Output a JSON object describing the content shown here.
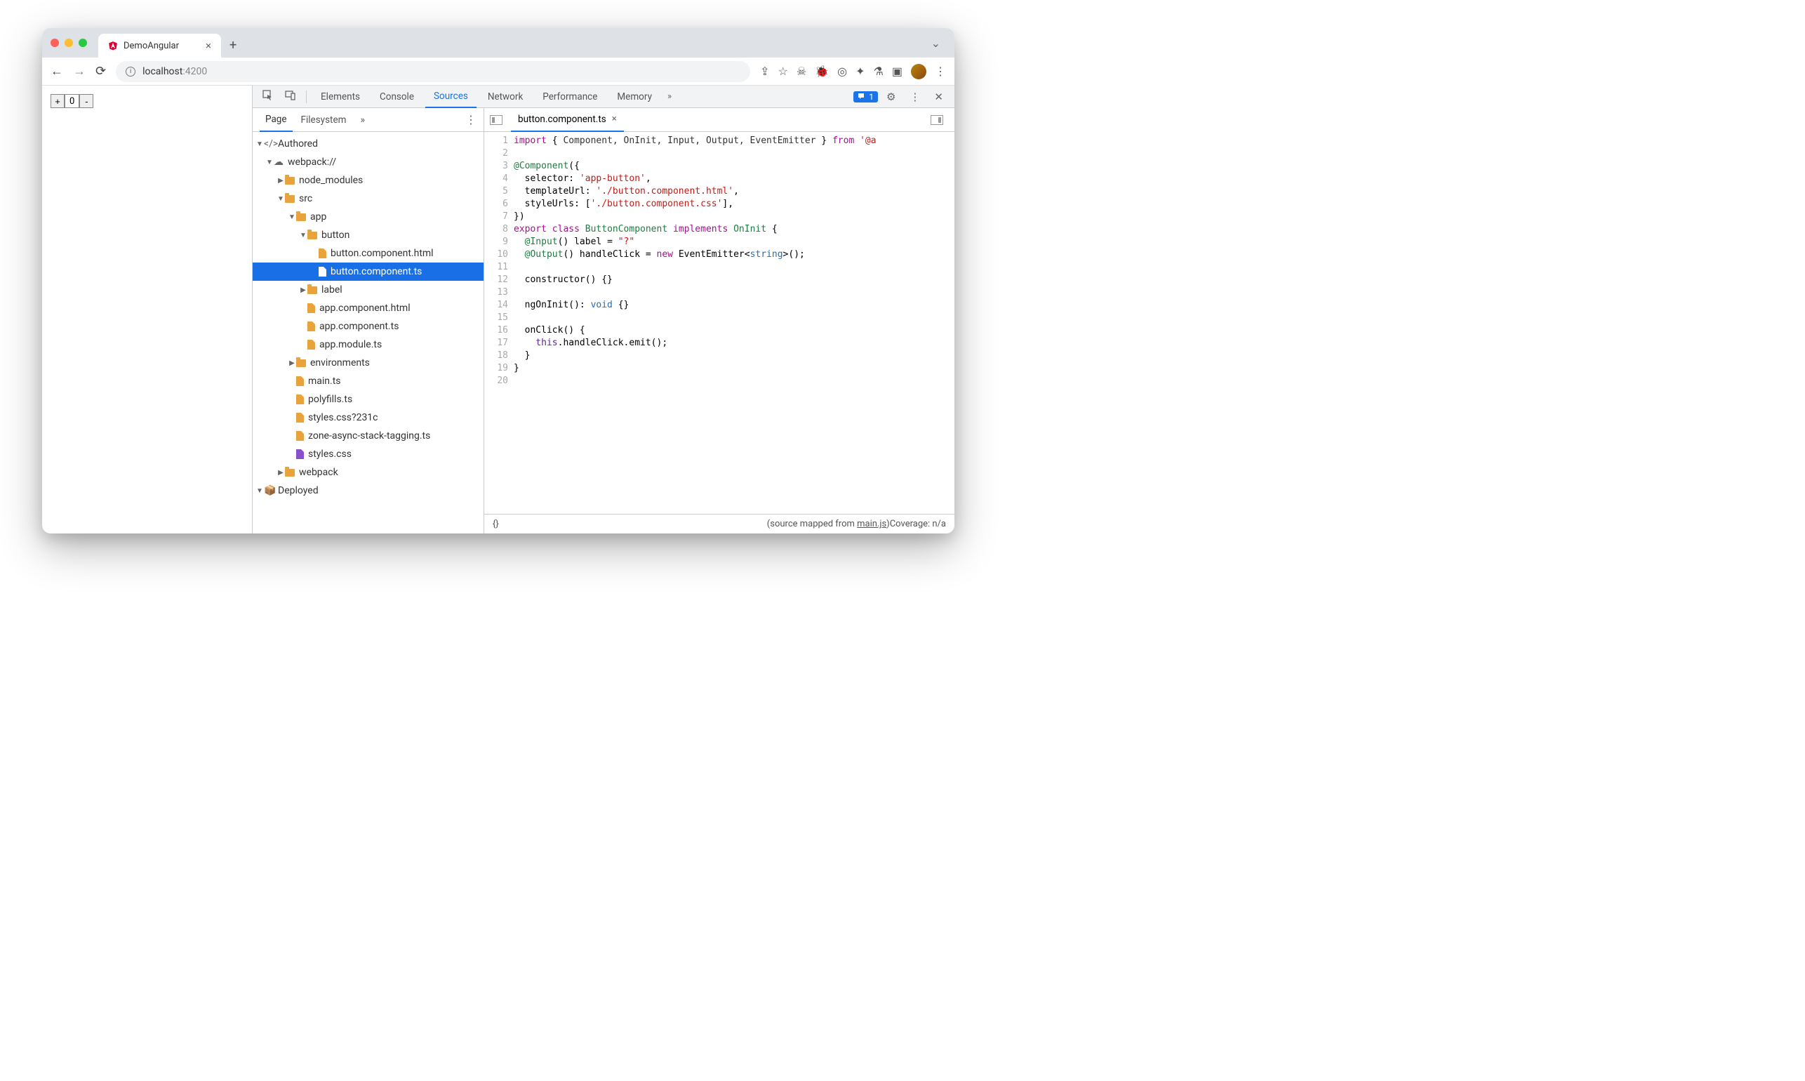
{
  "browser": {
    "tab_title": "DemoAngular",
    "url_host": "localhost",
    "url_port": ":4200"
  },
  "page": {
    "counter_minus": "-",
    "counter_value": "0",
    "counter_plus": "+"
  },
  "devtools": {
    "tabs": [
      "Elements",
      "Console",
      "Sources",
      "Network",
      "Performance",
      "Memory"
    ],
    "active_tab": "Sources",
    "more_glyph": "»",
    "issues_badge": "1",
    "sidebar_tabs": [
      "Page",
      "Filesystem"
    ],
    "sidebar_more": "»",
    "active_sidebar_tab": "Page",
    "tree": {
      "authored": "Authored",
      "webpack": "webpack://",
      "node_modules": "node_modules",
      "src": "src",
      "app": "app",
      "button": "button",
      "button_html": "button.component.html",
      "button_ts": "button.component.ts",
      "label": "label",
      "app_html": "app.component.html",
      "app_ts": "app.component.ts",
      "app_module": "app.module.ts",
      "environments": "environments",
      "main_ts": "main.ts",
      "polyfills": "polyfills.ts",
      "styles_q": "styles.css?231c",
      "zone": "zone-async-stack-tagging.ts",
      "styles": "styles.css",
      "webpack_folder": "webpack",
      "deployed": "Deployed"
    },
    "open_file": "button.component.ts",
    "code_lines": {
      "1": {
        "import": "import",
        "lb": " { ",
        "ids": "Component, OnInit, Input, Output, EventEmitter",
        "rb": " } ",
        "from": "from",
        "str": "'@a"
      },
      "2": "",
      "3": {
        "deco": "@Component",
        "rest": "({"
      },
      "4": {
        "key": "  selector: ",
        "val": "'app-button'",
        "end": ","
      },
      "5": {
        "key": "  templateUrl: ",
        "val": "'./button.component.html'",
        "end": ","
      },
      "6": {
        "key": "  styleUrls: [",
        "val": "'./button.component.css'",
        "end": "],"
      },
      "7": "})",
      "8": {
        "exp": "export",
        "cls": "class",
        "name": "ButtonComponent",
        "impl": "implements",
        "iface": "OnInit",
        "end": " {"
      },
      "9": {
        "deco": "  @Input",
        "rest": "() label = ",
        "val": "\"?\""
      },
      "10": {
        "deco": "  @Output",
        "rest": "() handleClick = ",
        "new": "new",
        "type": " EventEmitter<",
        "gen": "string",
        "end": ">();"
      },
      "11": "",
      "12": "  constructor() {}",
      "13": "",
      "14": {
        "pre": "  ngOnInit(): ",
        "void": "void",
        "end": " {}"
      },
      "15": "",
      "16": "  onClick() {",
      "17": {
        "pre": "    ",
        "this": "this",
        "rest": ".handleClick.emit();"
      },
      "18": "  }",
      "19": "}",
      "20": ""
    },
    "status": {
      "braces": "{}",
      "mapped_prefix": "(source mapped from ",
      "mapped_link": "main.js",
      "mapped_suffix": ")",
      "coverage": " Coverage: n/a"
    }
  }
}
